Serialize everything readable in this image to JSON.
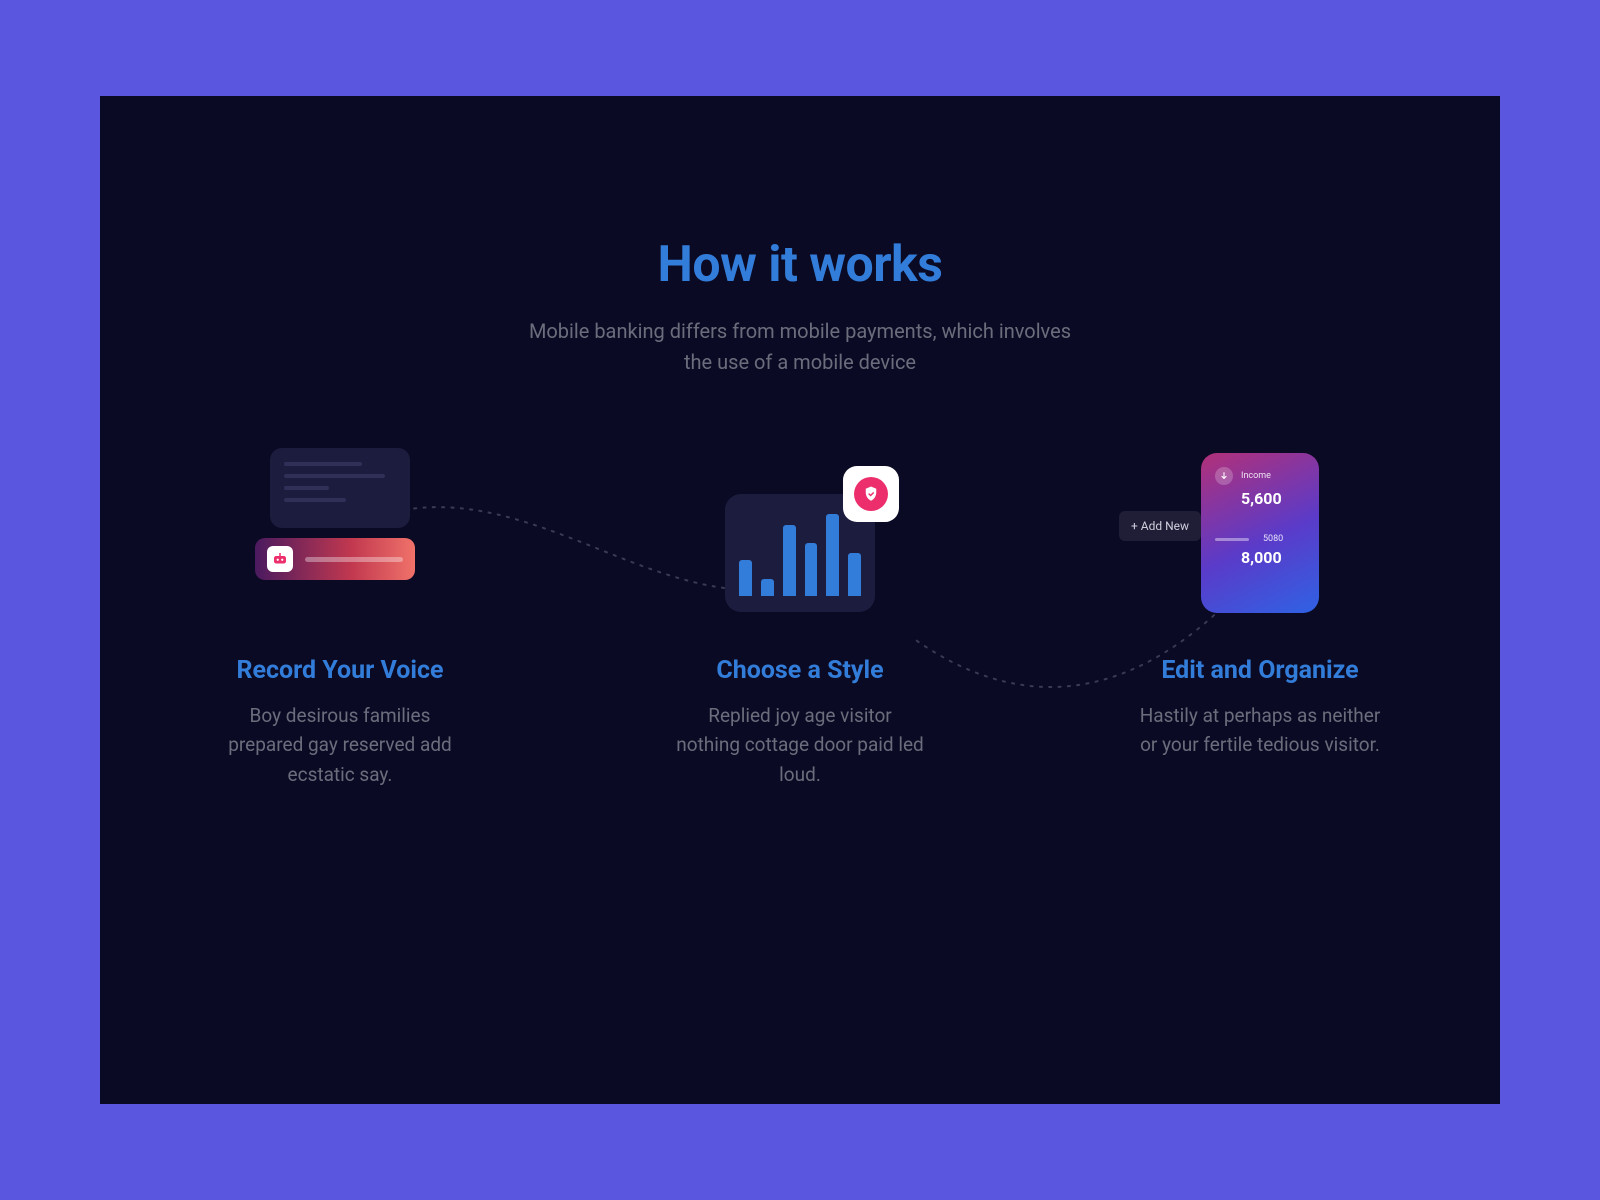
{
  "heading": "How it works",
  "subheading": "Mobile banking differs from mobile payments, which involves the use of a mobile device",
  "features": [
    {
      "title": "Record Your Voice",
      "desc": "Boy desirous families prepared gay reserved add ecstatic say."
    },
    {
      "title": "Choose a Style",
      "desc": "Replied joy age visitor nothing cottage door paid led loud."
    },
    {
      "title": "Edit and Organize",
      "desc": "Hastily at perhaps as neither or your fertile tedious visitor."
    }
  ],
  "illus3": {
    "income_label": "Income",
    "income_value": "5,600",
    "second_label": "5080",
    "second_value": "8,000",
    "addnew": "+ Add New"
  }
}
